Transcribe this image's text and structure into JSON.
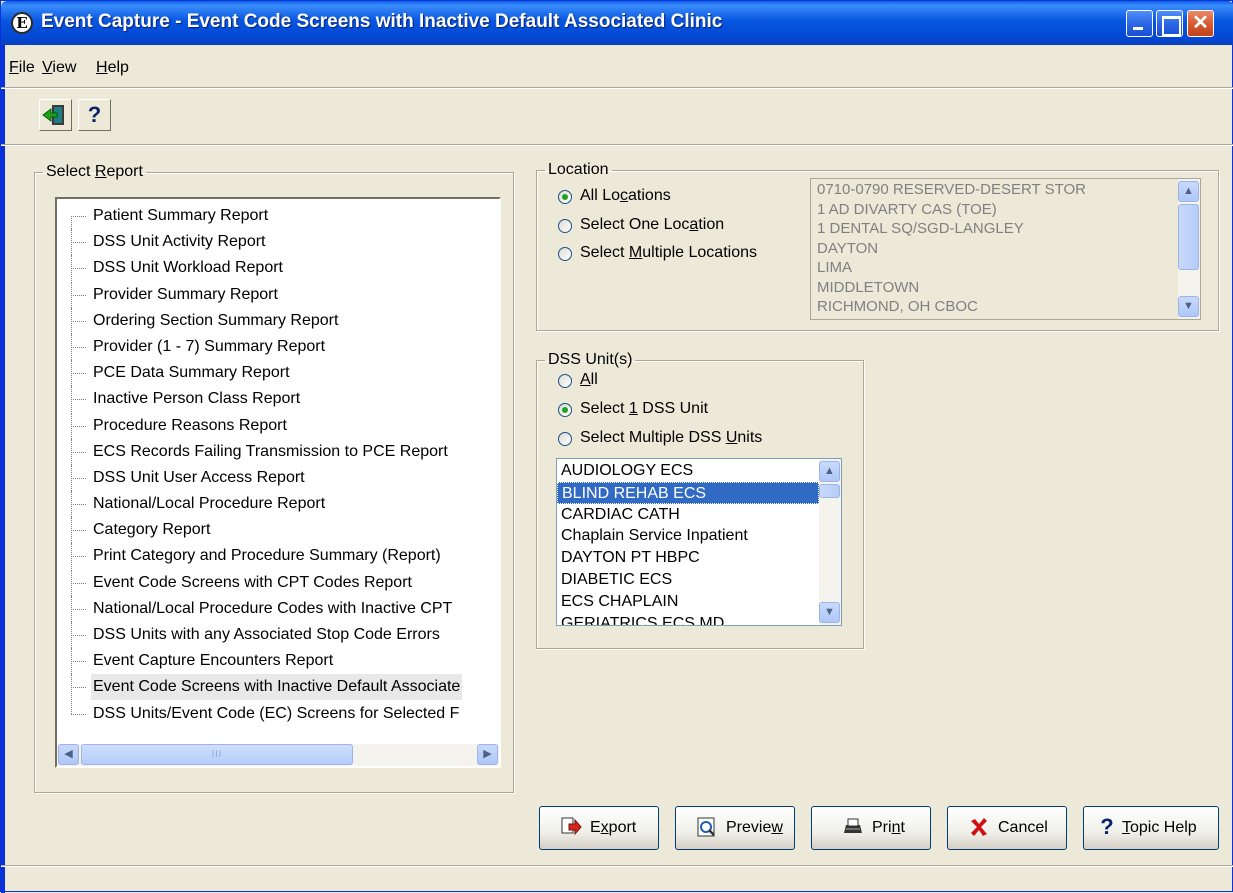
{
  "window": {
    "title": "Event Capture - Event Code Screens with Inactive Default Associated Clinic",
    "app_icon": "E",
    "close_glyph": "✕"
  },
  "menu": [
    {
      "label": "File",
      "key": "F",
      "rest": "ile"
    },
    {
      "label": "View",
      "key": "V",
      "rest": "iew"
    },
    {
      "label": "Help",
      "key": "H",
      "rest": "elp"
    }
  ],
  "toolbar": {
    "exit_icon": "exit-door-icon",
    "help_glyph": "?"
  },
  "select_report": {
    "legend_pre": "Select ",
    "legend_key": "R",
    "legend_post": "eport",
    "items": [
      "Patient Summary Report",
      "DSS Unit Activity Report",
      "DSS Unit Workload Report",
      "Provider Summary Report",
      "Ordering Section Summary Report",
      "Provider (1 - 7) Summary Report",
      "PCE Data Summary Report",
      "Inactive Person Class Report",
      "Procedure Reasons Report",
      "ECS Records Failing Transmission to PCE Report",
      "DSS Unit User Access Report",
      "National/Local Procedure Report",
      "Category Report",
      "Print Category and Procedure Summary (Report)",
      "Event Code Screens with CPT Codes Report",
      "National/Local Procedure Codes with Inactive CPT",
      "DSS Units with any Associated Stop Code Errors",
      "Event Capture Encounters Report",
      "Event Code Screens with Inactive Default Associate",
      "DSS Units/Event Code (EC) Screens for Selected F"
    ],
    "selected_index": 18,
    "scroll_thumb_grip": "III"
  },
  "location": {
    "legend": "Location",
    "options": [
      {
        "pre": "All Lo",
        "key": "c",
        "post": "ations",
        "checked": true
      },
      {
        "pre": "Select One Loc",
        "key": "a",
        "post": "tion",
        "checked": false
      },
      {
        "pre": "Select ",
        "key": "M",
        "post": "ultiple Locations",
        "checked": false
      }
    ],
    "list": [
      "0710-0790 RESERVED-DESERT STOR",
      "1 AD DIVARTY CAS (TOE)",
      "1 DENTAL SQ/SGD-LANGLEY",
      "DAYTON",
      "LIMA",
      "MIDDLETOWN",
      "RICHMOND, OH CBOC"
    ]
  },
  "dss_units": {
    "legend": "DSS Unit(s)",
    "options": [
      {
        "pre": "",
        "key": "A",
        "post": "ll",
        "checked": false
      },
      {
        "pre": "Select ",
        "key": "1",
        "post": " DSS Unit",
        "checked": true
      },
      {
        "pre": "Select Multiple DSS ",
        "key": "U",
        "post": "nits",
        "checked": false
      }
    ],
    "list": [
      "AUDIOLOGY ECS",
      "BLIND REHAB ECS",
      "CARDIAC CATH",
      "Chaplain Service Inpatient",
      "DAYTON PT HBPC",
      "DIABETIC ECS",
      "ECS CHAPLAIN",
      "GERIATRICS ECS MD"
    ],
    "selected_index": 1
  },
  "buttons": {
    "export": {
      "pre": "E",
      "key": "x",
      "post": "port",
      "icon": "export-icon"
    },
    "preview": {
      "pre": "Previe",
      "key": "w",
      "post": "",
      "icon": "preview-icon"
    },
    "print": {
      "pre": "Pri",
      "key": "n",
      "post": "t",
      "icon": "printer-icon"
    },
    "cancel": {
      "pre": "Cancel",
      "key": "",
      "post": "",
      "icon": "cancel-x-icon"
    },
    "topic_help": {
      "pre": "",
      "key": "T",
      "post": "opic Help",
      "icon": "help-question-icon"
    }
  },
  "colors": {
    "title_bar": "#0a5fe8",
    "selection": "#316ac5",
    "window_bg": "#ece9d8"
  }
}
